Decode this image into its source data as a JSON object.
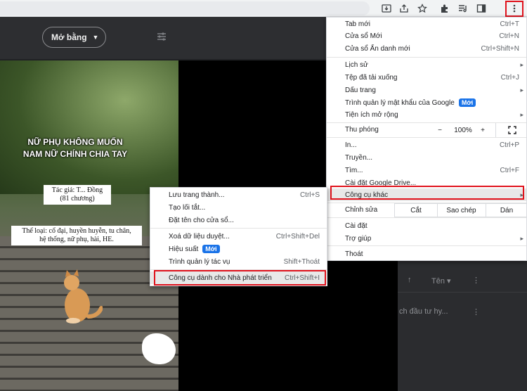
{
  "toolbar": {
    "icons": [
      "install-icon",
      "share-icon",
      "star-icon",
      "extensions-icon",
      "reading-list-icon",
      "side-panel-icon",
      "kebab-menu-icon"
    ]
  },
  "page": {
    "open_button": "Mở bằng",
    "cover": {
      "title_line1": "NỮ PHỤ KHÔNG MUỐN",
      "title_line2": "NAM NỮ CHÍNH CHIA TAY",
      "author_line1": "Tác giả: T... Đồng",
      "author_line2": "(81 chương)",
      "genre_line1": "Thể loại: cổ đại, huyền huyễn, tu chân,",
      "genre_line2": "hệ thống, nữ phụ, hài, HE."
    },
    "side_panel": {
      "sort_label": "Tên",
      "item_text": "ch đầu tư hy..."
    }
  },
  "main_menu": {
    "new_tab": "Tab mới",
    "new_tab_sc": "Ctrl+T",
    "new_window": "Cửa sổ Mới",
    "new_window_sc": "Ctrl+N",
    "incognito": "Cửa sổ Ẩn danh mới",
    "incognito_sc": "Ctrl+Shift+N",
    "history": "Lịch sử",
    "downloads": "Tệp đã tải xuống",
    "downloads_sc": "Ctrl+J",
    "bookmarks": "Dấu trang",
    "passwords": "Trình quản lý mật khẩu của Google",
    "new_badge": "Mới",
    "extensions": "Tiện ích mở rộng",
    "zoom": "Thu phóng",
    "zoom_minus": "−",
    "zoom_value": "100%",
    "zoom_plus": "+",
    "print": "In...",
    "print_sc": "Ctrl+P",
    "cast": "Truyền...",
    "find": "Tìm...",
    "find_sc": "Ctrl+F",
    "install": "Cài đặt Google Drive...",
    "more_tools": "Công cụ khác",
    "edit": "Chỉnh sửa",
    "cut": "Cắt",
    "copy": "Sao chép",
    "paste": "Dán",
    "settings": "Cài đặt",
    "help": "Trợ giúp",
    "exit": "Thoát"
  },
  "sub_menu": {
    "save_page": "Lưu trang thành...",
    "save_page_sc": "Ctrl+S",
    "create_shortcut": "Tạo lối tắt...",
    "name_window": "Đặt tên cho cửa sổ...",
    "clear_data": "Xoá dữ liệu duyệt...",
    "clear_data_sc": "Ctrl+Shift+Del",
    "performance": "Hiệu suất",
    "new_badge": "Mới",
    "task_manager": "Trình quản lý tác vụ",
    "task_manager_sc": "Shift+Thoát",
    "dev_tools": "Công cụ dành cho Nhà phát triển",
    "dev_tools_sc": "Ctrl+Shift+I"
  },
  "colors": {
    "highlight_box": "#e0121c",
    "badge": "#1a73e8"
  }
}
